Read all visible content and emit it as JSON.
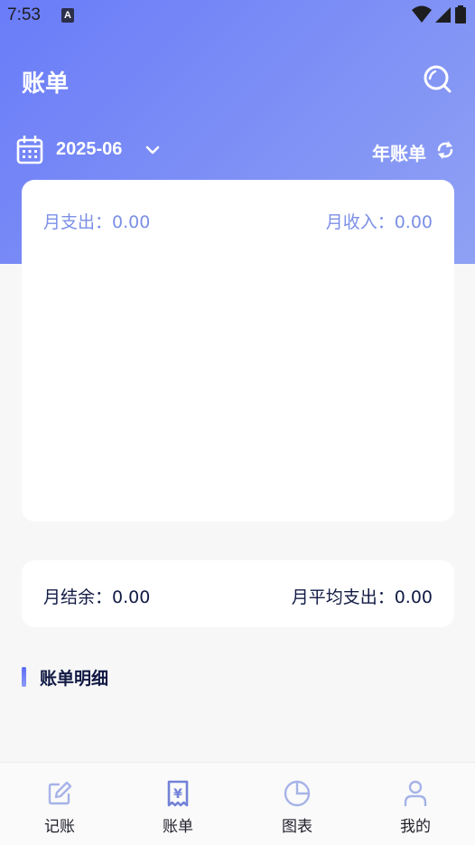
{
  "status_bar": {
    "time": "7:53",
    "notification_glyph": "A"
  },
  "header": {
    "title": "账单"
  },
  "month_selector": {
    "month": "2025-06",
    "year_bill_label": "年账单"
  },
  "summary": {
    "expense": "月支出：0.00",
    "income": "月收入：0.00"
  },
  "balance": {
    "balance": "月结余：0.00",
    "avg_expense": "月平均支出：0.00"
  },
  "detail": {
    "title": "账单明细"
  },
  "tabs": [
    {
      "label": "记账",
      "icon": "edit-icon",
      "active": false
    },
    {
      "label": "账单",
      "icon": "receipt-icon",
      "active": true
    },
    {
      "label": "图表",
      "icon": "pie-chart-icon",
      "active": false
    },
    {
      "label": "我的",
      "icon": "user-icon",
      "active": false
    }
  ],
  "colors": {
    "accent": "#6a7cf8",
    "summary_text": "#7b8fe6",
    "dark_text": "#111a44",
    "tab_icon_active": "#7282d8",
    "tab_icon_inactive": "#a6b3e8"
  }
}
